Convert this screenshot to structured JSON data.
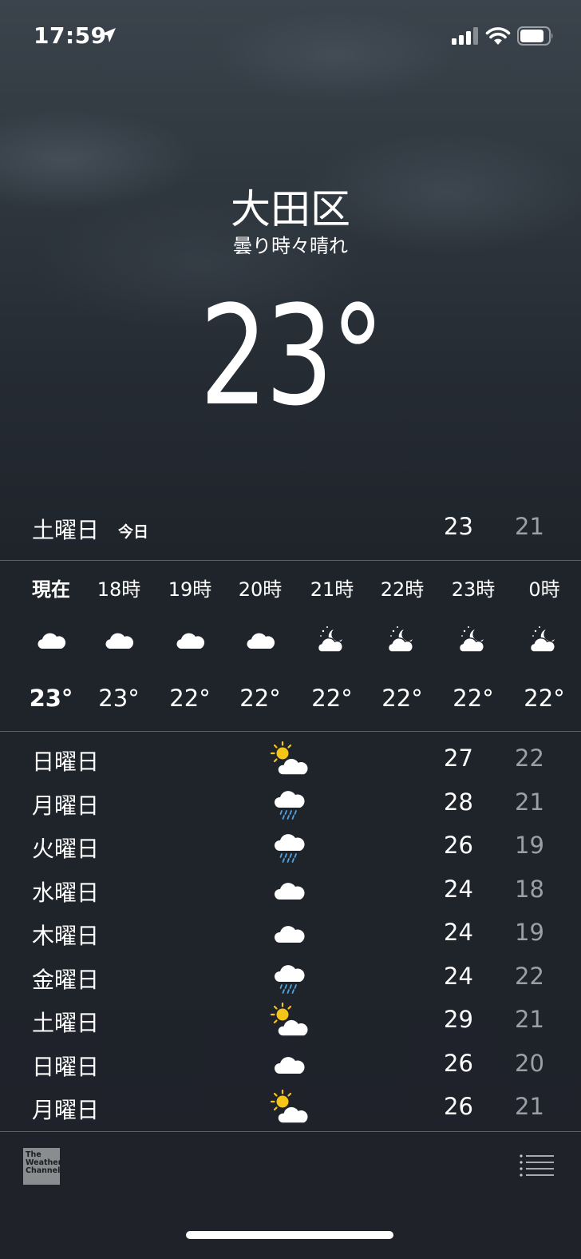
{
  "status_bar": {
    "time": "17:59"
  },
  "location": {
    "city": "大田区",
    "condition": "曇り時々晴れ",
    "temperature": "23°"
  },
  "today": {
    "day": "土曜日",
    "badge": "今日",
    "high": "23",
    "low": "21"
  },
  "hourly": [
    {
      "label": "現在",
      "icon": "cloud-icon",
      "temp": "23°"
    },
    {
      "label": "18時",
      "icon": "cloud-icon",
      "temp": "23°"
    },
    {
      "label": "19時",
      "icon": "cloud-icon",
      "temp": "22°"
    },
    {
      "label": "20時",
      "icon": "cloud-icon",
      "temp": "22°"
    },
    {
      "label": "21時",
      "icon": "moon-cloud-icon",
      "temp": "22°"
    },
    {
      "label": "22時",
      "icon": "moon-cloud-icon",
      "temp": "22°"
    },
    {
      "label": "23時",
      "icon": "moon-cloud-icon",
      "temp": "22°"
    },
    {
      "label": "0時",
      "icon": "moon-cloud-icon",
      "temp": "22°"
    }
  ],
  "daily": [
    {
      "day": "日曜日",
      "icon": "sun-cloud-icon",
      "high": "27",
      "low": "22"
    },
    {
      "day": "月曜日",
      "icon": "rain-cloud-icon",
      "high": "28",
      "low": "21"
    },
    {
      "day": "火曜日",
      "icon": "rain-cloud-icon",
      "high": "26",
      "low": "19"
    },
    {
      "day": "水曜日",
      "icon": "cloud-icon",
      "high": "24",
      "low": "18"
    },
    {
      "day": "木曜日",
      "icon": "cloud-icon",
      "high": "24",
      "low": "19"
    },
    {
      "day": "金曜日",
      "icon": "rain-cloud-icon",
      "high": "24",
      "low": "22"
    },
    {
      "day": "土曜日",
      "icon": "sun-cloud-icon",
      "high": "29",
      "low": "21"
    },
    {
      "day": "日曜日",
      "icon": "cloud-icon",
      "high": "26",
      "low": "20"
    },
    {
      "day": "月曜日",
      "icon": "sun-cloud-icon",
      "high": "26",
      "low": "21"
    }
  ],
  "footer": {
    "logo_lines": [
      "The",
      "Weather",
      "Channel"
    ]
  },
  "colors": {
    "low_temp": "#9aa0a6",
    "sun": "#f5c518",
    "rain": "#4fa3e0"
  }
}
